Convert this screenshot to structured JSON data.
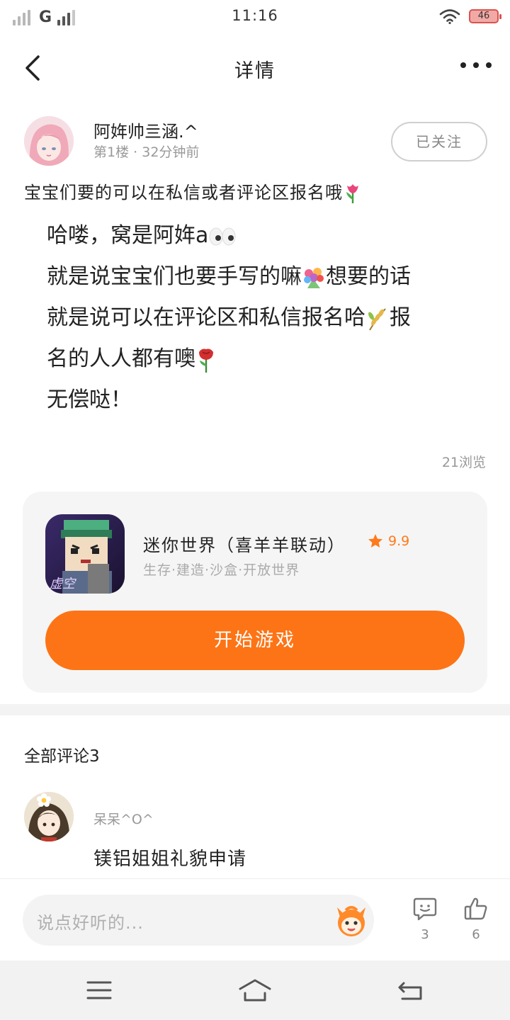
{
  "status_bar": {
    "time": "11:16",
    "network": "G",
    "battery": "46"
  },
  "nav": {
    "title": "详情"
  },
  "author": {
    "name": "阿姩帅亖涵.^",
    "floor": "第1楼",
    "time_ago": "32分钟前",
    "follow_label": "已关注"
  },
  "post": {
    "title": "宝宝们要的可以在私信或者评论区报名哦",
    "lines": [
      "哈喽，窝是阿姩a",
      "就是说宝宝们也要手写的嘛",
      "想要的话",
      "就是说可以在评论区和私信报名哈",
      "报",
      "名的人人都有噢",
      "无偿哒！"
    ],
    "views": "21浏览"
  },
  "game": {
    "name": "迷你世界（喜羊羊联动）",
    "rating": "9.9",
    "tags": "生存·建造·沙盒·开放世界",
    "start_label": "开始游戏",
    "icon_text": "虚空"
  },
  "comments": {
    "header": "全部评论3",
    "items": [
      {
        "user": "呆呆^O^",
        "text": "镁铝姐姐礼貌申请"
      }
    ]
  },
  "bottom": {
    "input_placeholder": "说点好听的...",
    "comment_count": "3",
    "like_count": "6"
  },
  "colors": {
    "accent": "#fd7416",
    "rating": "#ff7a1a",
    "battery_low": "#d9534f"
  }
}
